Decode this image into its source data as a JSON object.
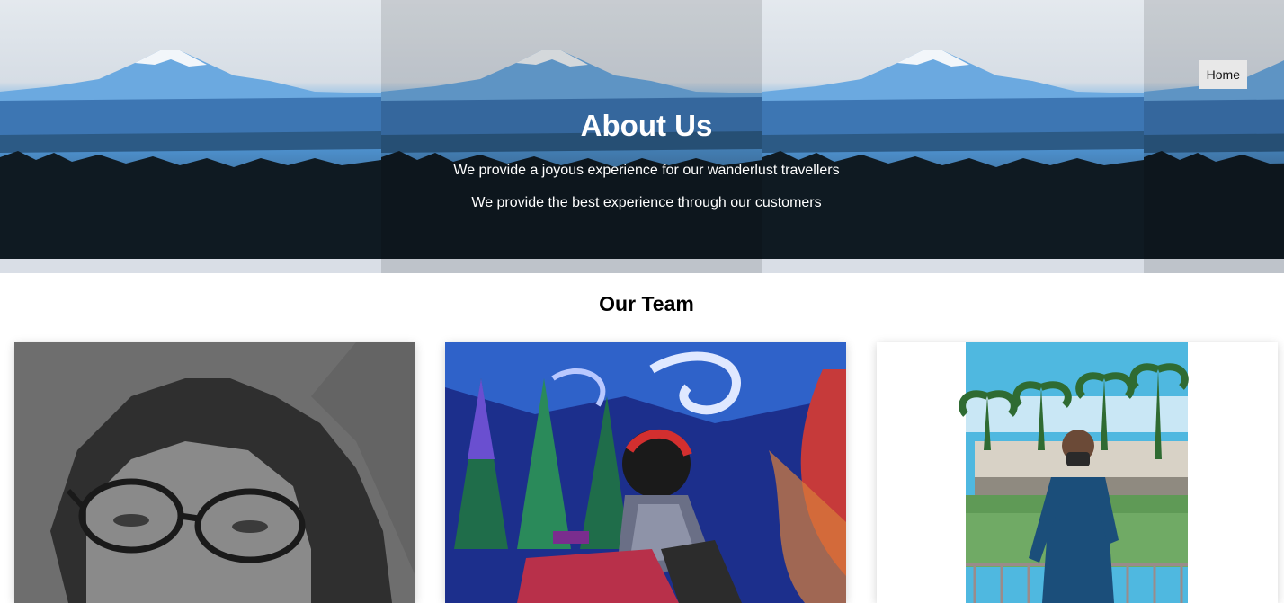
{
  "hero": {
    "title": "About Us",
    "line1": "We provide a joyous experience for our wanderlust travellers",
    "line2": "We provide the best experience through our customers",
    "nav_home": "Home"
  },
  "team": {
    "heading": "Our Team"
  }
}
